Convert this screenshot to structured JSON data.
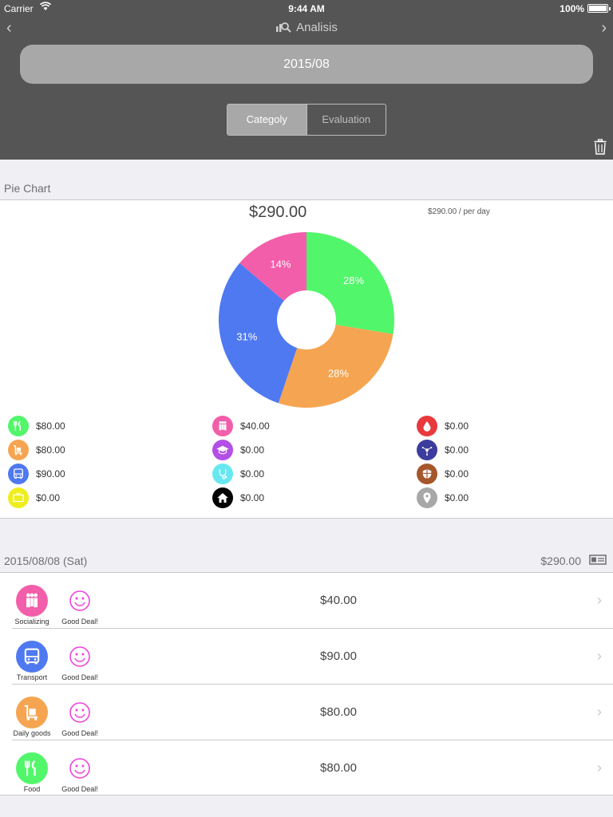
{
  "status": {
    "carrier": "Carrier",
    "time": "9:44 AM",
    "battery": "100%"
  },
  "nav": {
    "title": "Analisis",
    "back_icon": "chevron-left",
    "forward_icon": "chevron-right"
  },
  "month": "2015/08",
  "segments": [
    {
      "label": "Categoly",
      "active": true
    },
    {
      "label": "Evaluation",
      "active": false
    }
  ],
  "pie_section": {
    "label": "Pie Chart",
    "total": "$290.00",
    "per_day": "$290.00 / per day"
  },
  "chart_data": {
    "type": "pie",
    "donut": true,
    "slices": [
      {
        "label": "Food",
        "percent": 28,
        "value": 80,
        "color": "#52f66a"
      },
      {
        "label": "Daily goods",
        "percent": 28,
        "value": 80,
        "color": "#f5a551"
      },
      {
        "label": "Transport",
        "percent": 31,
        "value": 90,
        "color": "#4f79f0"
      },
      {
        "label": "Socializing",
        "percent": 14,
        "value": 40,
        "color": "#f25ea9"
      }
    ],
    "slice_labels": [
      "28%",
      "28%",
      "31%",
      "14%"
    ]
  },
  "legend": [
    {
      "value": "$80.00",
      "color": "#52f66a",
      "icon": "fork-knife-icon"
    },
    {
      "value": "$80.00",
      "color": "#f5a551",
      "icon": "cart-icon"
    },
    {
      "value": "$90.00",
      "color": "#4f79f0",
      "icon": "bus-icon"
    },
    {
      "value": "$0.00",
      "color": "#eeee1e",
      "icon": "tv-icon"
    },
    {
      "value": "$40.00",
      "color": "#f25ea9",
      "icon": "people-icon"
    },
    {
      "value": "$0.00",
      "color": "#b34fe6",
      "icon": "graduation-cap-icon"
    },
    {
      "value": "$0.00",
      "color": "#67e8f0",
      "icon": "stethoscope-icon"
    },
    {
      "value": "$0.00",
      "color": "#000000",
      "icon": "house-icon"
    },
    {
      "value": "$0.00",
      "color": "#e8393c",
      "icon": "drop-icon"
    },
    {
      "value": "$0.00",
      "color": "#3c3c9e",
      "icon": "network-icon"
    },
    {
      "value": "$0.00",
      "color": "#a5562b",
      "icon": "shield-icon"
    },
    {
      "value": "$0.00",
      "color": "#a8a8a8",
      "icon": "map-pin-icon"
    }
  ],
  "day": {
    "date": "2015/08/08 (Sat)",
    "total": "$290.00",
    "rows": [
      {
        "category": "Socializing",
        "color": "#f25ea9",
        "icon": "people-icon",
        "evaluation": "Good Deal!",
        "amount": "$40.00"
      },
      {
        "category": "Transport",
        "color": "#4f79f0",
        "icon": "bus-icon",
        "evaluation": "Good Deal!",
        "amount": "$90.00"
      },
      {
        "category": "Daily goods",
        "color": "#f5a551",
        "icon": "cart-icon",
        "evaluation": "Good Deal!",
        "amount": "$80.00"
      },
      {
        "category": "Food",
        "color": "#52f66a",
        "icon": "fork-knife-icon",
        "evaluation": "Good Deal!",
        "amount": "$80.00"
      }
    ]
  }
}
